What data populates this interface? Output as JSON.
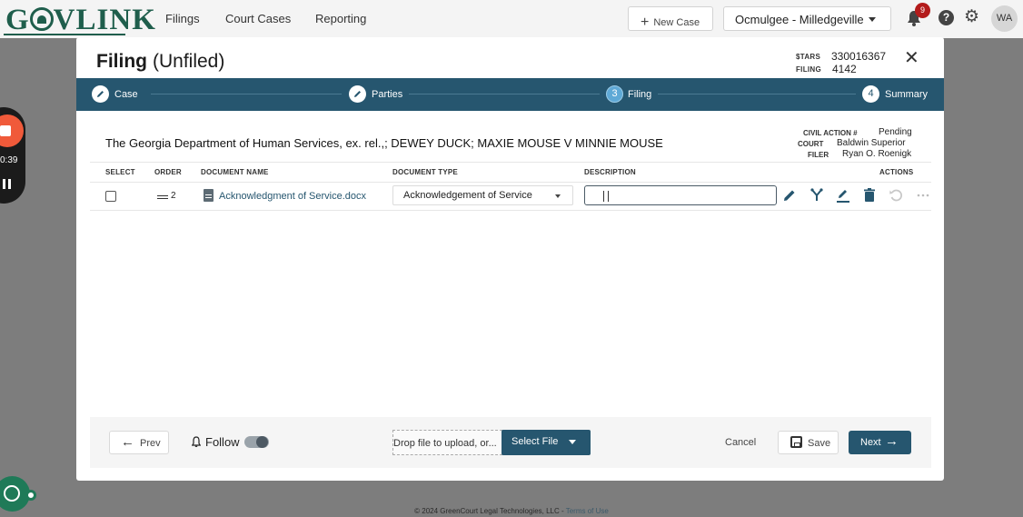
{
  "app": {
    "logo": "GOVLINK",
    "nav": [
      "Filings",
      "Court Cases",
      "Reporting"
    ],
    "new_case": "New Case",
    "court": "Ocmulgee - Milledgeville",
    "notifications": "9",
    "avatar": "WA",
    "footer": "© 2024 GreenCourt Legal Technologies, LLC - ",
    "terms": "Terms of Use"
  },
  "recorder": {
    "time": "0:39"
  },
  "modal": {
    "title": "Filing",
    "status": "(Unfiled)",
    "stars_label": "$TARS",
    "stars_value": "330016367",
    "filing_label": "FILING",
    "filing_value": "4142"
  },
  "steps": [
    {
      "num": "",
      "label": "Case",
      "state": "done"
    },
    {
      "num": "",
      "label": "Parties",
      "state": "done"
    },
    {
      "num": "3",
      "label": "Filing",
      "state": "active"
    },
    {
      "num": "4",
      "label": "Summary",
      "state": "todo"
    }
  ],
  "case": {
    "title": "The Georgia Department of Human Services, ex. rel.,; DEWEY DUCK; MAXIE MOUSE V MINNIE MOUSE",
    "civil_action_label": "CIVIL ACTION #",
    "civil_action_value": "Pending",
    "court_label": "COURT",
    "court_value": "Baldwin Superior",
    "filer_label": "FILER",
    "filer_value": "Ryan O. Roenigk"
  },
  "table": {
    "headers": [
      "SELECT",
      "ORDER",
      "DOCUMENT NAME",
      "DOCUMENT TYPE",
      "DESCRIPTION",
      "ACTIONS"
    ],
    "rows": [
      {
        "order": "2",
        "document_name": "Acknowledgment of Service.docx",
        "document_type": "Acknowledgement of Service",
        "description": ""
      }
    ]
  },
  "footer": {
    "prev": "Prev",
    "follow": "Follow",
    "drop_text": "Drop file to upload, or...",
    "select_file": "Select File",
    "cancel": "Cancel",
    "save": "Save",
    "next": "Next"
  },
  "colors": {
    "primary": "#26566f",
    "active_step": "#5fa9d6",
    "brand_green": "#1f5e4c",
    "badge_red": "#b31b1b"
  }
}
